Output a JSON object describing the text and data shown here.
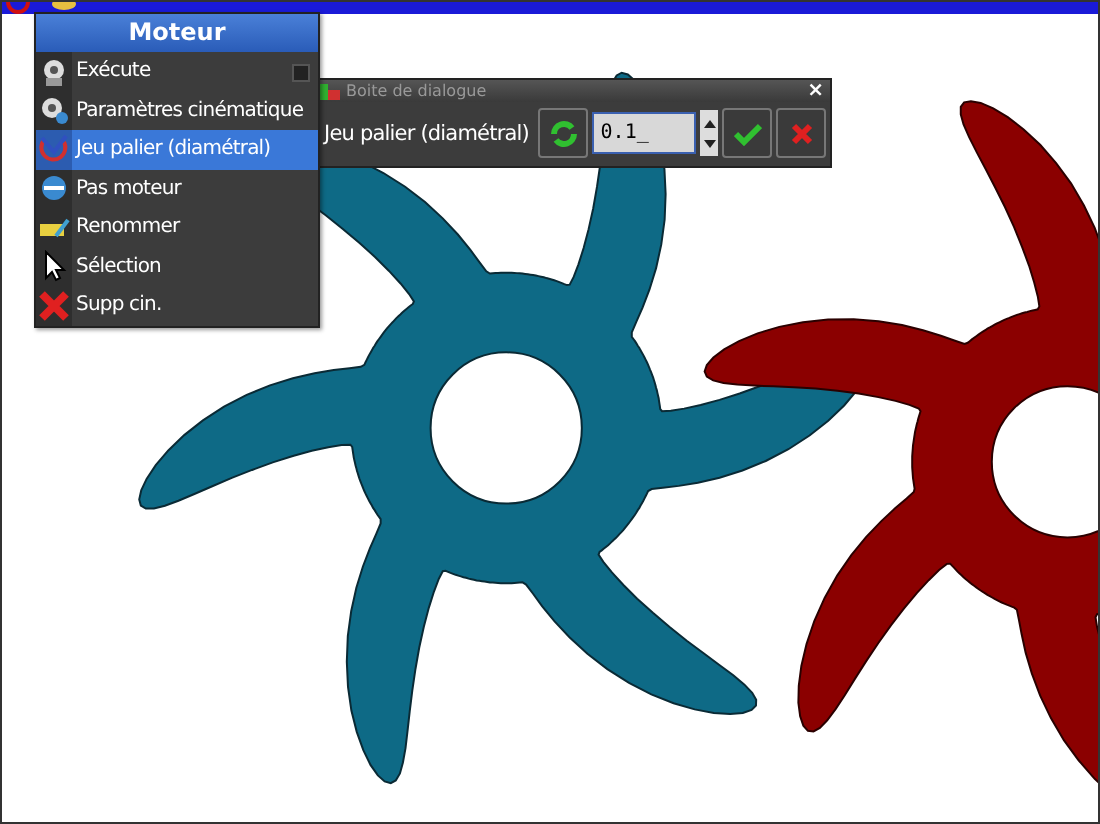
{
  "menu": {
    "title": "Moteur",
    "items": [
      {
        "label": "Exécute",
        "selected": false,
        "indicator": true
      },
      {
        "label": "Paramètres cinématique",
        "selected": false,
        "indicator": false
      },
      {
        "label": "Jeu palier (diamétral)",
        "selected": true,
        "indicator": false
      },
      {
        "label": "Pas moteur",
        "selected": false,
        "indicator": false
      },
      {
        "label": "Renommer",
        "selected": false,
        "indicator": false
      },
      {
        "label": "Sélection",
        "selected": false,
        "indicator": false
      },
      {
        "label": "Supp cin.",
        "selected": false,
        "indicator": false
      }
    ]
  },
  "dialog": {
    "title": "Boite de dialogue",
    "close": "×",
    "label": "Jeu palier (diamétral)",
    "value": "0.1_"
  }
}
